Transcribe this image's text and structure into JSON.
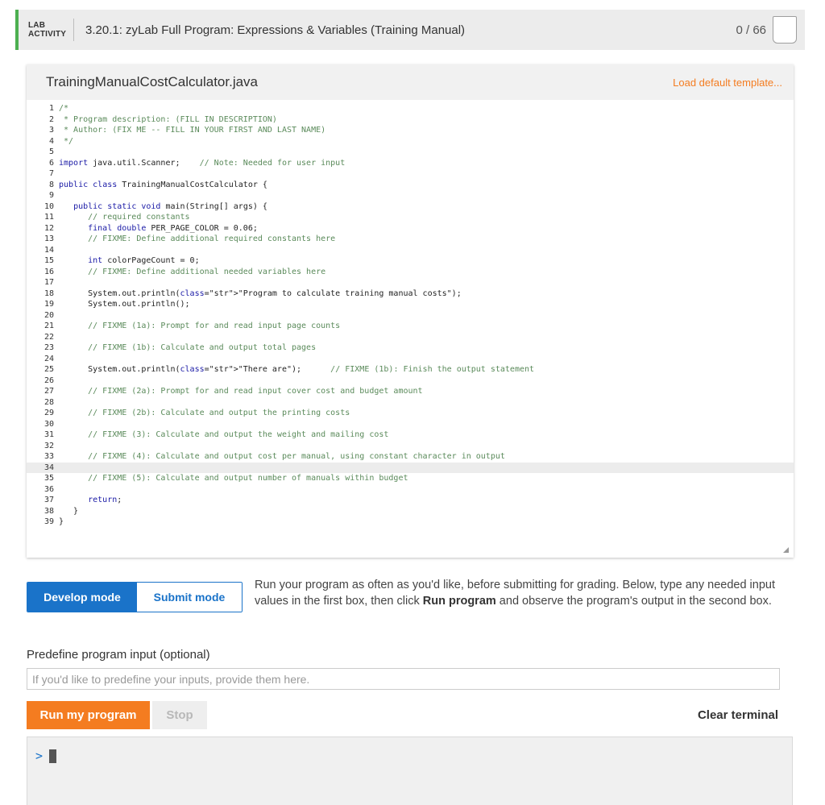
{
  "lab": {
    "tag_line1": "LAB",
    "tag_line2": "ACTIVITY",
    "title": "3.20.1: zyLab Full Program: Expressions & Variables (Training Manual)",
    "score": "0 / 66"
  },
  "editor": {
    "file_name": "TrainingManualCostCalculator.java",
    "load_default": "Load default template...",
    "active_line": 34,
    "lines": [
      "/*",
      " * Program description: (FILL IN DESCRIPTION)",
      " * Author: (FIX ME -- FILL IN YOUR FIRST AND LAST NAME)",
      " */",
      "",
      "import java.util.Scanner;    // Note: Needed for user input",
      "",
      "public class TrainingManualCostCalculator {",
      "",
      "   public static void main(String[] args) {",
      "      // required constants",
      "      final double PER_PAGE_COLOR = 0.06;",
      "      // FIXME: Define additional required constants here",
      "",
      "      int colorPageCount = 0;",
      "      // FIXME: Define additional needed variables here",
      "",
      "      System.out.println(\"Program to calculate training manual costs\");",
      "      System.out.println();",
      "",
      "      // FIXME (1a): Prompt for and read input page counts",
      "",
      "      // FIXME (1b): Calculate and output total pages",
      "",
      "      System.out.println(\"There are\");      // FIXME (1b): Finish the output statement",
      "",
      "      // FIXME (2a): Prompt for and read input cover cost and budget amount",
      "",
      "      // FIXME (2b): Calculate and output the printing costs",
      "",
      "      // FIXME (3): Calculate and output the weight and mailing cost",
      "",
      "      // FIXME (4): Calculate and output cost per manual, using constant character in output",
      "",
      "      // FIXME (5): Calculate and output number of manuals within budget",
      "",
      "      return;",
      "   }",
      "}"
    ]
  },
  "modes": {
    "develop": "Develop mode",
    "submit": "Submit mode",
    "description_part1": "Run your program as often as you'd like, before submitting for grading. Below, type any needed input values in the first box, then click ",
    "description_bold": "Run program",
    "description_part2": " and observe the program's output in the second box."
  },
  "input": {
    "label": "Predefine program input (optional)",
    "placeholder": "If you'd like to predefine your inputs, provide them here.",
    "value": ""
  },
  "controls": {
    "run": "Run my program",
    "stop": "Stop",
    "clear": "Clear terminal"
  },
  "terminal": {
    "prompt": ">"
  },
  "colors": {
    "accent_green": "#4caf50",
    "accent_orange": "#f47c20",
    "accent_blue": "#1a73c9"
  }
}
